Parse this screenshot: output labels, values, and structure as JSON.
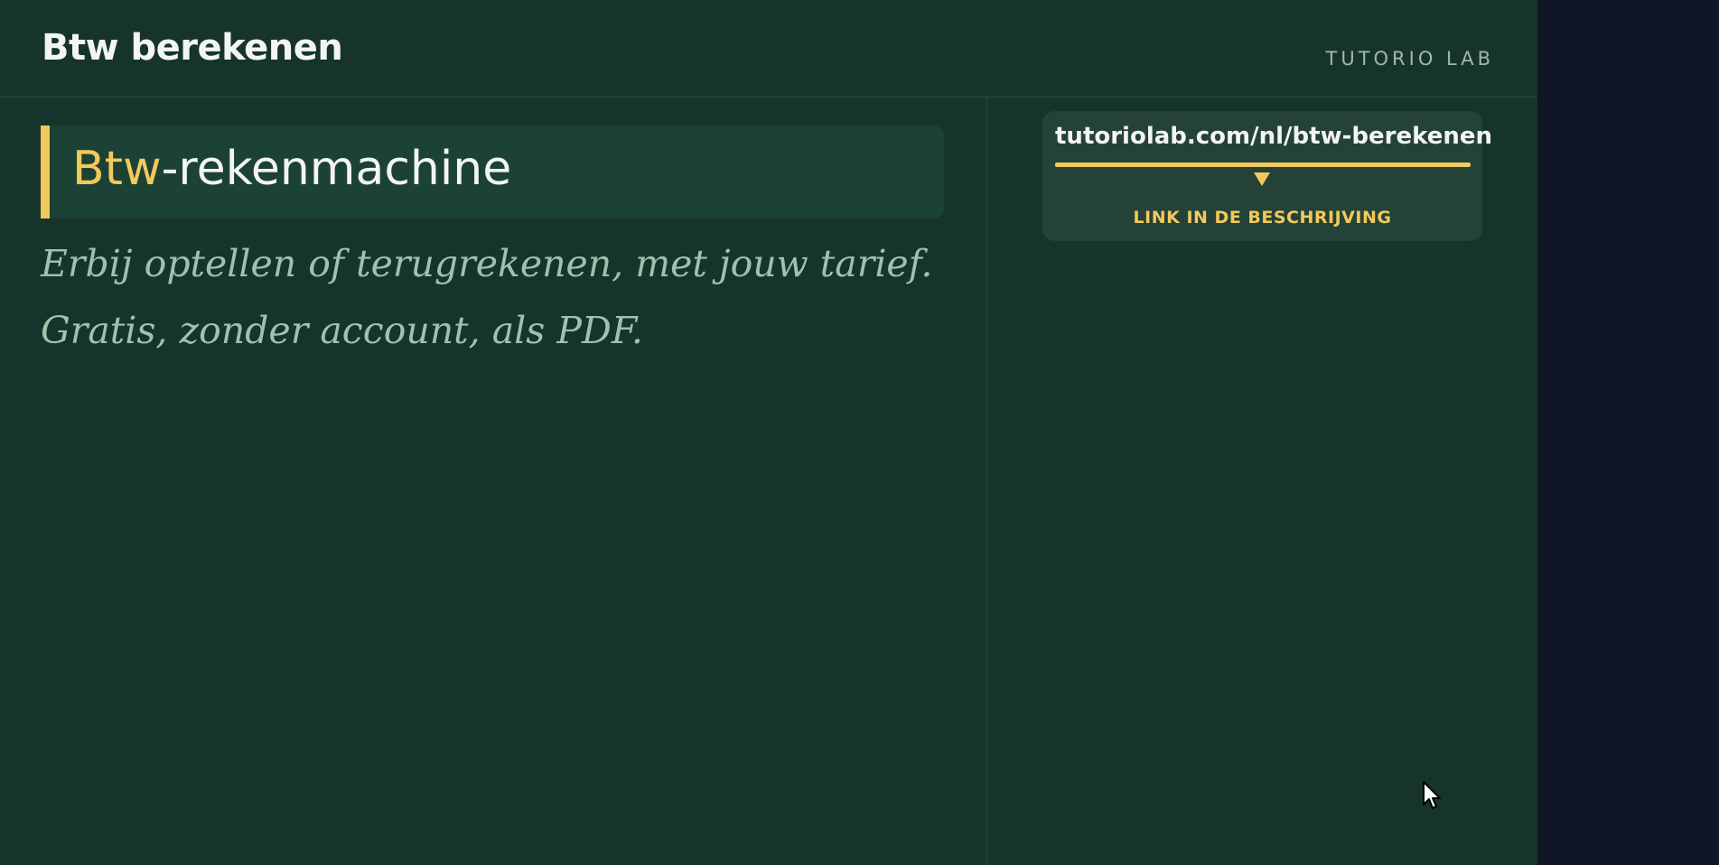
{
  "header": {
    "title": "Btw berekenen",
    "brand": "TUTORIO LAB"
  },
  "hero": {
    "title_accent": "Btw",
    "title_rest": "-rekenmachine",
    "subtitle_line1": "Erbij optellen of terugrekenen, met jouw tarief.",
    "subtitle_line2": "Gratis, zonder account, als PDF."
  },
  "link_card": {
    "url": "tutoriolab.com/nl/btw-berekenen",
    "caption": "LINK IN DE BESCHRIJVING",
    "arrow_icon": "arrow-down-icon"
  },
  "colors": {
    "background": "#16342b",
    "accent": "#f2c95c",
    "text": "#f3f5f0",
    "muted": "#9fc1ae",
    "side_strip": "#111627"
  },
  "cursor_icon": "mouse-pointer-icon"
}
